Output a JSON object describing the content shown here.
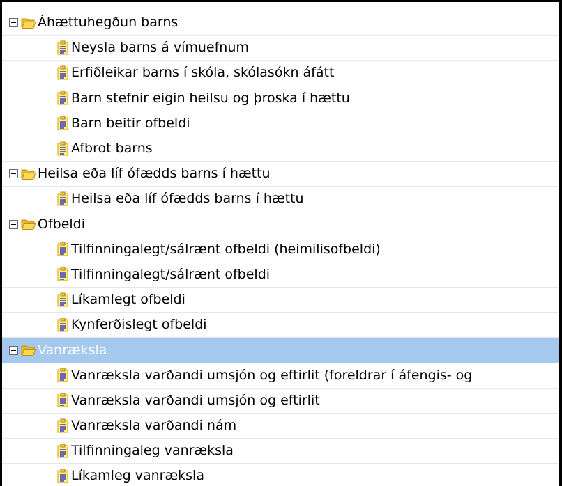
{
  "tree": {
    "selected_group": "Vanræksla",
    "groups": [
      {
        "label": "Áhættuhegðun barns",
        "children": [
          "Neysla barns á vímuefnum",
          "Erfiðleikar barns í skóla, skólasókn áfátt",
          "Barn stefnir eigin heilsu og þroska í hættu",
          "Barn beitir ofbeldi",
          "Afbrot barns"
        ]
      },
      {
        "label": "Heilsa eða líf ófædds barns í hættu",
        "children": [
          "Heilsa eða líf ófædds barns í hættu"
        ]
      },
      {
        "label": "Ofbeldi",
        "children": [
          "Tilfinningalegt/sálrænt ofbeldi (heimilisofbeldi)",
          "Tilfinningalegt/sálrænt ofbeldi",
          "Líkamlegt ofbeldi",
          "Kynferðislegt ofbeldi"
        ]
      },
      {
        "label": "Vanræksla",
        "children": [
          "Vanræksla varðandi umsjón og eftirlit (foreldrar í áfengis- og",
          "Vanræksla varðandi umsjón og eftirlit",
          "Vanræksla varðandi nám",
          "Tilfinningaleg vanræksla",
          "Líkamleg vanræksla"
        ]
      }
    ]
  },
  "icons": {
    "toggle": "collapse-minus-icon",
    "group": "folder-open-icon",
    "leaf": "document-icon"
  },
  "colors": {
    "selection": "#a5c8ee",
    "selected_text": "#ffffff",
    "folder": "#f5cf45",
    "doc_lines": "#2d2dd0",
    "doc_paper": "#fff27a"
  }
}
